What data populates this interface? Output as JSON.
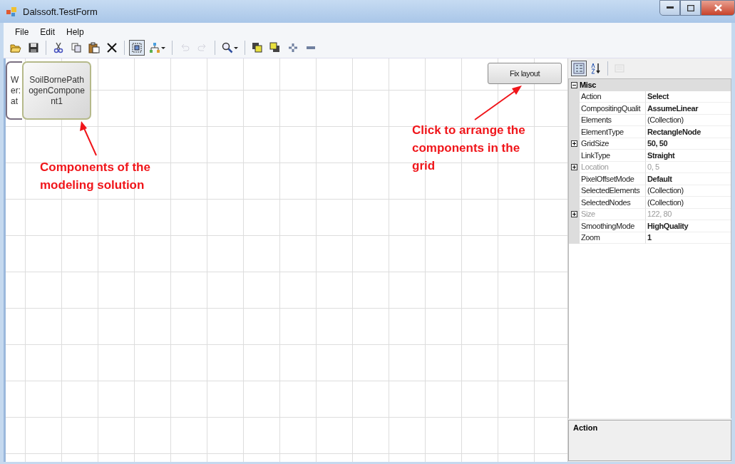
{
  "window": {
    "title": "Dalssoft.TestForm"
  },
  "menu": [
    "File",
    "Edit",
    "Help"
  ],
  "toolbar": [
    {
      "kind": "open",
      "pressed": false,
      "disabled": false
    },
    {
      "kind": "save",
      "pressed": false,
      "disabled": false
    },
    {
      "kind": "separator"
    },
    {
      "kind": "cut",
      "pressed": false,
      "disabled": false
    },
    {
      "kind": "copy",
      "pressed": false,
      "disabled": false
    },
    {
      "kind": "paste",
      "pressed": false,
      "disabled": false
    },
    {
      "kind": "delete",
      "pressed": false,
      "disabled": false
    },
    {
      "kind": "separator"
    },
    {
      "kind": "select",
      "pressed": true,
      "disabled": false
    },
    {
      "kind": "layout",
      "pressed": false,
      "disabled": false,
      "dropdown": true
    },
    {
      "kind": "separator"
    },
    {
      "kind": "undo",
      "pressed": false,
      "disabled": true
    },
    {
      "kind": "redo",
      "pressed": false,
      "disabled": true
    },
    {
      "kind": "separator"
    },
    {
      "kind": "zoom",
      "pressed": false,
      "disabled": false,
      "dropdown": true
    },
    {
      "kind": "separator"
    },
    {
      "kind": "front",
      "pressed": false,
      "disabled": false
    },
    {
      "kind": "back",
      "pressed": false,
      "disabled": false
    },
    {
      "kind": "add",
      "pressed": false,
      "disabled": false
    },
    {
      "kind": "remove",
      "pressed": false,
      "disabled": false
    }
  ],
  "canvas": {
    "nodes": [
      {
        "kind": "partial",
        "lines": [
          "W",
          "er:",
          "at"
        ]
      },
      {
        "kind": "full",
        "lines": [
          "SoilBornePath",
          "ogenCompone",
          "nt1"
        ]
      }
    ],
    "fix_button": "Fix layout",
    "annotations": [
      {
        "text": "Components of the modeling solution"
      },
      {
        "text": "Click to arrange the components in the grid"
      }
    ]
  },
  "property_grid": {
    "toolbar": [
      {
        "kind": "categorized",
        "pressed": true,
        "disabled": false
      },
      {
        "kind": "alphabetical",
        "pressed": false,
        "disabled": false
      },
      {
        "kind": "separator"
      },
      {
        "kind": "pages",
        "pressed": false,
        "disabled": true
      }
    ],
    "category": {
      "name": "Misc",
      "expanded": true
    },
    "rows": [
      {
        "name": "Action",
        "value": "Select",
        "bold": true,
        "disabled": false,
        "expandable": false
      },
      {
        "name": "CompositingQualit",
        "value": "AssumeLinear",
        "bold": true,
        "disabled": false,
        "expandable": false
      },
      {
        "name": "Elements",
        "value": "(Collection)",
        "bold": false,
        "disabled": false,
        "expandable": false
      },
      {
        "name": "ElementType",
        "value": "RectangleNode",
        "bold": true,
        "disabled": false,
        "expandable": false
      },
      {
        "name": "GridSize",
        "value": "50, 50",
        "bold": true,
        "disabled": false,
        "expandable": true
      },
      {
        "name": "LinkType",
        "value": "Straight",
        "bold": true,
        "disabled": false,
        "expandable": false
      },
      {
        "name": "Location",
        "value": "0, 5",
        "bold": false,
        "disabled": true,
        "expandable": true
      },
      {
        "name": "PixelOffsetMode",
        "value": "Default",
        "bold": true,
        "disabled": false,
        "expandable": false
      },
      {
        "name": "SelectedElements",
        "value": "(Collection)",
        "bold": false,
        "disabled": false,
        "expandable": false
      },
      {
        "name": "SelectedNodes",
        "value": "(Collection)",
        "bold": false,
        "disabled": false,
        "expandable": false
      },
      {
        "name": "Size",
        "value": "122, 80",
        "bold": false,
        "disabled": true,
        "expandable": true
      },
      {
        "name": "SmoothingMode",
        "value": "HighQuality",
        "bold": true,
        "disabled": false,
        "expandable": false
      },
      {
        "name": "Zoom",
        "value": "1",
        "bold": true,
        "disabled": false,
        "expandable": false
      }
    ],
    "description": {
      "title": "Action"
    }
  }
}
